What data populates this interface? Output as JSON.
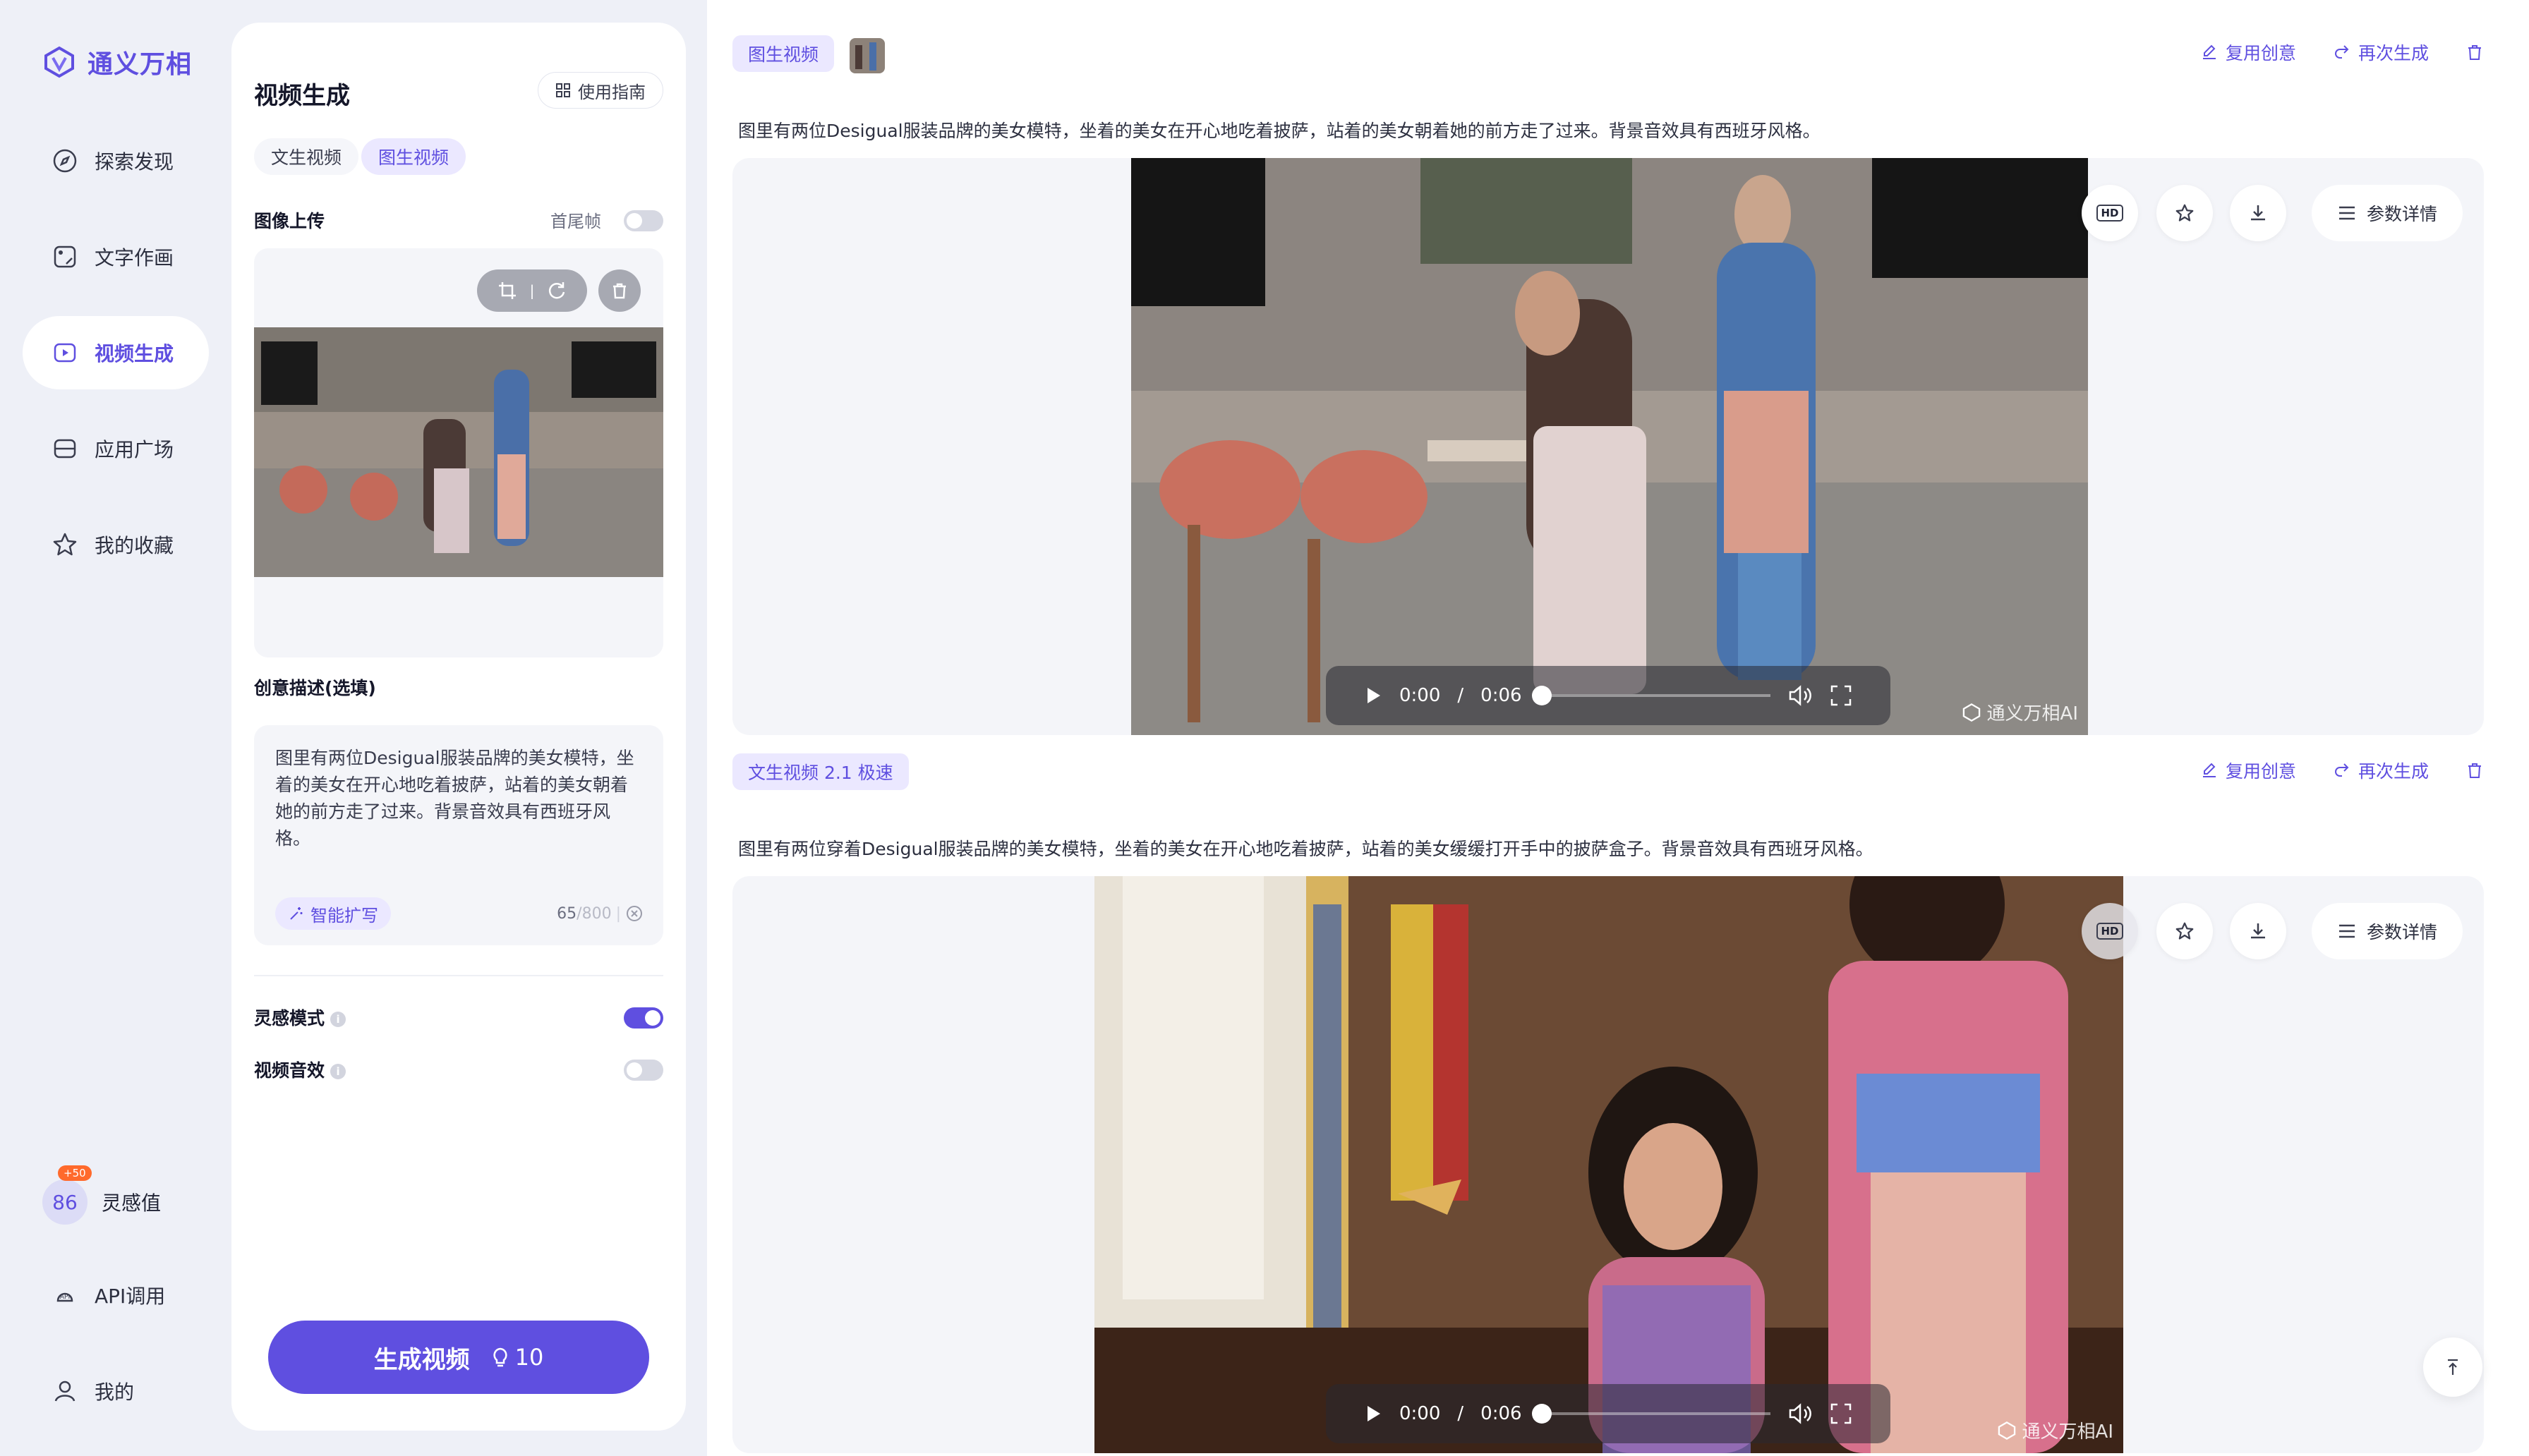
{
  "app": {
    "logo_text": "通义万相"
  },
  "nav": {
    "items": [
      {
        "label": "探索发现",
        "icon": "compass-icon"
      },
      {
        "label": "文字作画",
        "icon": "image-edit-icon"
      },
      {
        "label": "视频生成",
        "icon": "video-play-icon",
        "active": true
      },
      {
        "label": "应用广场",
        "icon": "apps-icon"
      },
      {
        "label": "我的收藏",
        "icon": "star-icon"
      }
    ],
    "points": {
      "value": "86",
      "badge": "+50",
      "label": "灵感值"
    },
    "api_label": "API调用",
    "profile_label": "我的"
  },
  "panel": {
    "title": "视频生成",
    "guide_label": "使用指南",
    "tabs": [
      "文生视频",
      "图生视频"
    ],
    "active_tab": "图生视频",
    "upload_label": "图像上传",
    "first_last_label": "首尾帧",
    "desc_label": "创意描述(选填)",
    "desc_text": "图里有两位Desigual服装品牌的美女模特，坐着的美女在开心地吃着披萨，站着的美女朝着她的前方走了过来。背景音效具有西班牙风格。",
    "expand_label": "智能扩写",
    "count": "65",
    "count_max": "/800",
    "inspiration_label": "灵感模式",
    "inspiration_on": true,
    "sfx_label": "视频音效",
    "sfx_on": false,
    "generate_label": "生成视频",
    "generate_cost": "10"
  },
  "cards": [
    {
      "type_label": "图生视频",
      "prompt": "图里有两位Desigual服装品牌的美女模特，坐着的美女在开心地吃着披萨，站着的美女朝着她的前方走了过来。背景音效具有西班牙风格。",
      "time": "0:00",
      "duration": "0:06"
    },
    {
      "type_label": "文生视频 2.1 极速",
      "prompt": "图里有两位穿着Desigual服装品牌的美女模特，坐着的美女在开心地吃着披萨，站着的美女缓缓打开手中的披萨盒子。背景音效具有西班牙风格。",
      "time": "0:00",
      "duration": "0:06"
    }
  ],
  "card_actions": {
    "reuse": "复用创意",
    "regenerate": "再次生成",
    "details": "参数详情",
    "hd": "HD",
    "time_sep": "/"
  },
  "watermark": "通义万相AI",
  "colors": {
    "accent": "#5f4fe0",
    "accent_light": "#ebe8ff",
    "badge": "#ff6a2c"
  }
}
